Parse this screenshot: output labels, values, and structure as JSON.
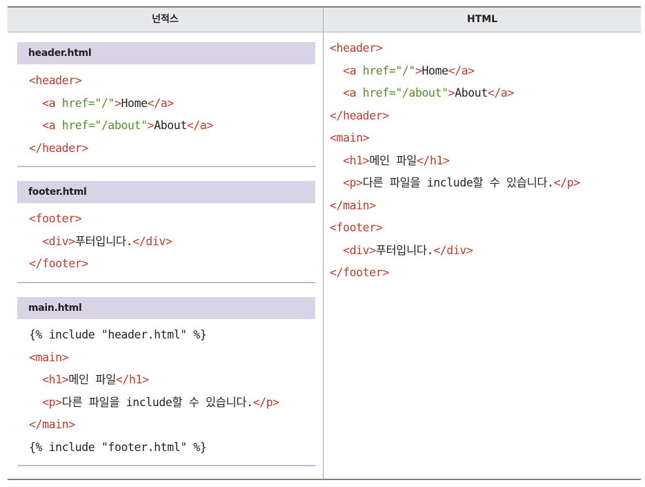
{
  "table": {
    "headers": {
      "syntax": "넌적스",
      "html": "HTML"
    },
    "sections": [
      {
        "title": "header.html",
        "lines": [
          [
            {
              "t": "<header>",
              "c": "tag"
            }
          ],
          [
            {
              "t": "  ",
              "c": "txt"
            },
            {
              "t": "<a",
              "c": "tag"
            },
            {
              "t": " href=\"/\"",
              "c": "attr"
            },
            {
              "t": ">",
              "c": "tag"
            },
            {
              "t": "Home",
              "c": "txt"
            },
            {
              "t": "</a>",
              "c": "tag"
            }
          ],
          [
            {
              "t": "  ",
              "c": "txt"
            },
            {
              "t": "<a",
              "c": "tag"
            },
            {
              "t": " href=\"/about\"",
              "c": "attr"
            },
            {
              "t": ">",
              "c": "tag"
            },
            {
              "t": "About",
              "c": "txt"
            },
            {
              "t": "</a>",
              "c": "tag"
            }
          ],
          [
            {
              "t": "</header>",
              "c": "tag"
            }
          ]
        ]
      },
      {
        "title": "footer.html",
        "lines": [
          [
            {
              "t": "<footer>",
              "c": "tag"
            }
          ],
          [
            {
              "t": "  ",
              "c": "txt"
            },
            {
              "t": "<div>",
              "c": "tag"
            },
            {
              "t": "푸터입니다.",
              "c": "txt"
            },
            {
              "t": "</div>",
              "c": "tag"
            }
          ],
          [
            {
              "t": "</footer>",
              "c": "tag"
            }
          ]
        ]
      },
      {
        "title": "main.html",
        "lines": [
          [
            {
              "t": "{% include \"header.html\" %}",
              "c": "txt"
            }
          ],
          [
            {
              "t": "<main>",
              "c": "tag"
            }
          ],
          [
            {
              "t": "  ",
              "c": "txt"
            },
            {
              "t": "<h1>",
              "c": "tag"
            },
            {
              "t": "메인 파일",
              "c": "txt"
            },
            {
              "t": "</h1>",
              "c": "tag"
            }
          ],
          [
            {
              "t": "  ",
              "c": "txt"
            },
            {
              "t": "<p>",
              "c": "tag"
            },
            {
              "t": "다른 파일을 include할 수 있습니다.",
              "c": "txt"
            },
            {
              "t": "</p>",
              "c": "tag"
            }
          ],
          [
            {
              "t": "</main>",
              "c": "tag"
            }
          ],
          [
            {
              "t": "{% include \"footer.html\" %}",
              "c": "txt"
            }
          ]
        ]
      }
    ],
    "result_lines": [
      [
        {
          "t": "<header>",
          "c": "tag"
        }
      ],
      [
        {
          "t": "  ",
          "c": "txt"
        },
        {
          "t": "<a",
          "c": "tag"
        },
        {
          "t": " href=\"/\"",
          "c": "attr"
        },
        {
          "t": ">",
          "c": "tag"
        },
        {
          "t": "Home",
          "c": "txt"
        },
        {
          "t": "</a>",
          "c": "tag"
        }
      ],
      [
        {
          "t": "  ",
          "c": "txt"
        },
        {
          "t": "<a",
          "c": "tag"
        },
        {
          "t": " href=\"/about\"",
          "c": "attr"
        },
        {
          "t": ">",
          "c": "tag"
        },
        {
          "t": "About",
          "c": "txt"
        },
        {
          "t": "</a>",
          "c": "tag"
        }
      ],
      [
        {
          "t": "</header>",
          "c": "tag"
        }
      ],
      [
        {
          "t": "<main>",
          "c": "tag"
        }
      ],
      [
        {
          "t": "  ",
          "c": "txt"
        },
        {
          "t": "<h1>",
          "c": "tag"
        },
        {
          "t": "메인 파일",
          "c": "txt"
        },
        {
          "t": "</h1>",
          "c": "tag"
        }
      ],
      [
        {
          "t": "  ",
          "c": "txt"
        },
        {
          "t": "<p>",
          "c": "tag"
        },
        {
          "t": "다른 파일을 include할 수 있습니다.",
          "c": "txt"
        },
        {
          "t": "</p>",
          "c": "tag"
        }
      ],
      [
        {
          "t": "</main>",
          "c": "tag"
        }
      ],
      [
        {
          "t": "<footer>",
          "c": "tag"
        }
      ],
      [
        {
          "t": "  ",
          "c": "txt"
        },
        {
          "t": "<div>",
          "c": "tag"
        },
        {
          "t": "푸터입니다.",
          "c": "txt"
        },
        {
          "t": "</div>",
          "c": "tag"
        }
      ],
      [
        {
          "t": "</footer>",
          "c": "tag"
        }
      ]
    ]
  },
  "colors": {
    "tag": "#c23a2b",
    "attr": "#5c8a2e",
    "text": "#231f20",
    "section_bar": "#d8d3e5",
    "header_row": "#e7e8ea"
  }
}
